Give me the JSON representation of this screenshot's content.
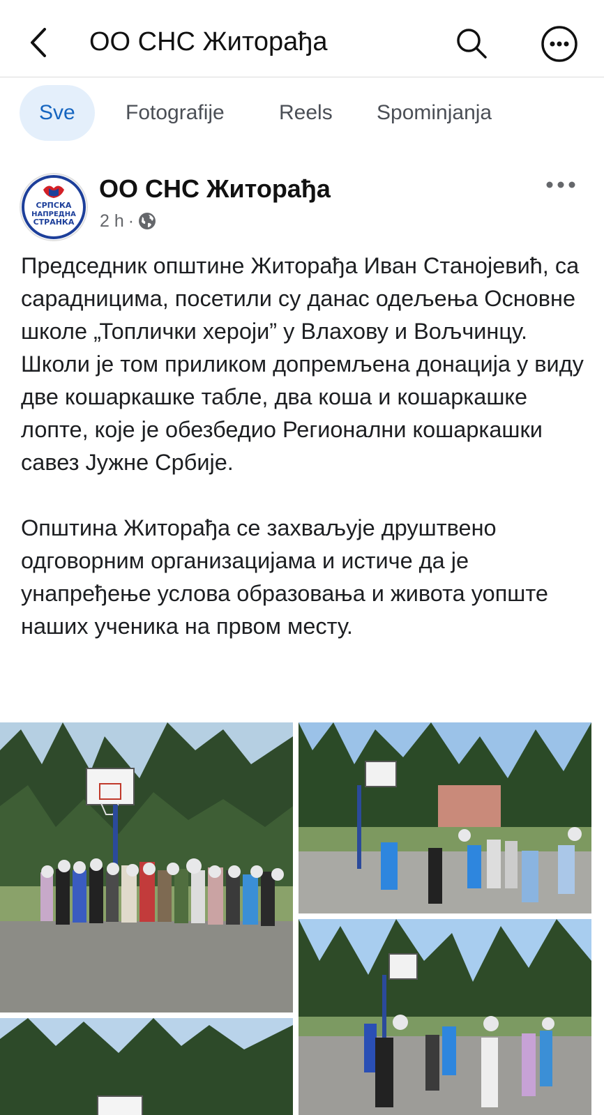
{
  "header": {
    "title": "ОО СНС Житорађа",
    "back_icon": "chevron-left-icon",
    "search_icon": "search-icon",
    "more_icon": "more-horizontal-circle-icon"
  },
  "tabs": [
    {
      "label": "Sve",
      "active": true
    },
    {
      "label": "Fotografije",
      "active": false
    },
    {
      "label": "Reels",
      "active": false
    },
    {
      "label": "Spominjanja",
      "active": false
    }
  ],
  "post": {
    "author": "ОО СНС Житорађа",
    "logo_text": [
      "СРПСКА",
      "НАПРЕДНА",
      "СТРАНКА"
    ],
    "time": "2 h",
    "separator": "·",
    "privacy_icon": "globe-icon",
    "options_icon": "more-horizontal-icon",
    "paragraphs": [
      "Председник општине Житорађа Иван Станојевић, са сарадницима, посетили су данас одељења Основне школе „Топлички хероји” у Влахову и Вољчинцу. Школи је том приликом допремљена донација у виду две кошаркашке табле, два коша и кошаркашке лопте, које је обезбедио Регионални кошаркашки савез Јужне Србије.",
      "Општина Житорађа се захваљује друштвено одговорним организацијама и истиче да је унапређење услова образовања и живота уопште наших ученика на првом месту."
    ],
    "photos": [
      {
        "name": "photo-group-basketball-court"
      },
      {
        "name": "photo-children-playing-1"
      },
      {
        "name": "photo-children-playing-2"
      },
      {
        "name": "photo-group-basketball-court-2"
      }
    ]
  },
  "colors": {
    "accent": "#1565c0",
    "active_tab_bg": "#e4effb",
    "secondary_text": "#65676b"
  }
}
